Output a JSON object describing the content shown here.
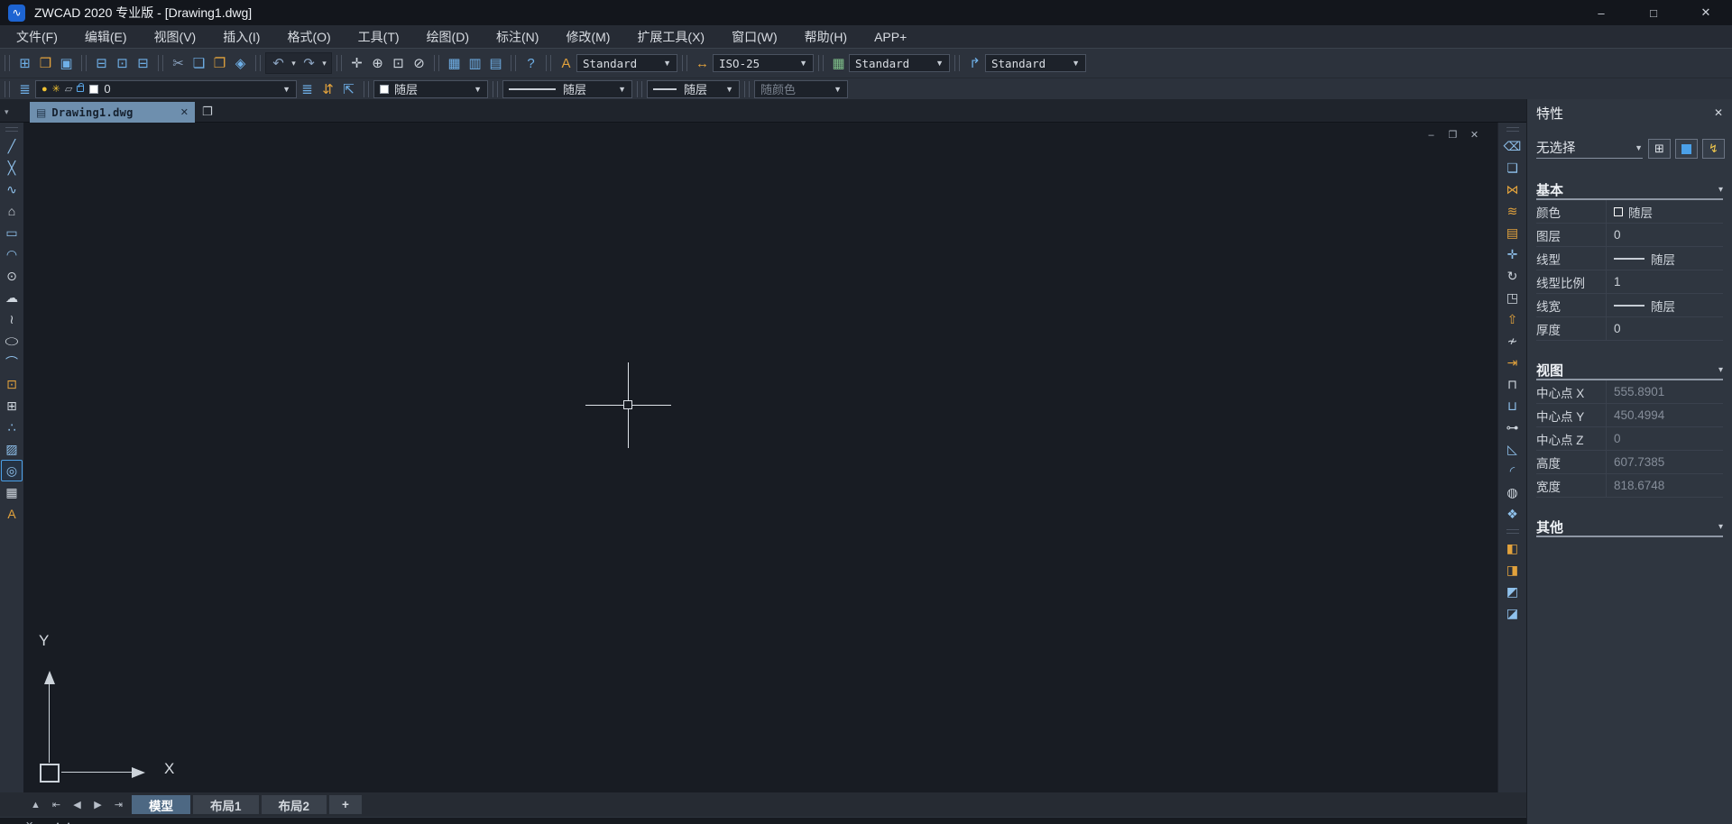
{
  "window": {
    "title": "ZWCAD 2020 专业版 - [Drawing1.dwg]"
  },
  "menu": {
    "items": [
      "文件(F)",
      "编辑(E)",
      "视图(V)",
      "插入(I)",
      "格式(O)",
      "工具(T)",
      "绘图(D)",
      "标注(N)",
      "修改(M)",
      "扩展工具(X)",
      "窗口(W)",
      "帮助(H)",
      "APP+"
    ]
  },
  "toolbars": {
    "styles": {
      "text_style": "Standard",
      "dim_style": "ISO-25",
      "table_style": "Standard",
      "mleader_style": "Standard"
    },
    "layer": {
      "current": "0",
      "color": "随层",
      "linetype": "随层",
      "lineweight": "随层",
      "plot_style": "随颜色"
    }
  },
  "doc_tab": {
    "name": "Drawing1.dwg"
  },
  "panel": {
    "title": "特性",
    "selection": "无选择",
    "basic": {
      "title": "基本",
      "rows": [
        {
          "label": "颜色",
          "value": "随层"
        },
        {
          "label": "图层",
          "value": "0"
        },
        {
          "label": "线型",
          "value": "随层"
        },
        {
          "label": "线型比例",
          "value": "1"
        },
        {
          "label": "线宽",
          "value": "随层"
        },
        {
          "label": "厚度",
          "value": "0"
        }
      ]
    },
    "view": {
      "title": "视图",
      "rows": [
        {
          "label": "中心点 X",
          "value": "555.8901"
        },
        {
          "label": "中心点 Y",
          "value": "450.4994"
        },
        {
          "label": "中心点 Z",
          "value": "0"
        },
        {
          "label": "高度",
          "value": "607.7385"
        },
        {
          "label": "宽度",
          "value": "818.6748"
        }
      ]
    },
    "other": {
      "title": "其他"
    }
  },
  "layout_tabs": {
    "model": "模型",
    "layout1": "布局1",
    "layout2": "布局2",
    "add": "+"
  },
  "ucs": {
    "x": "X",
    "y": "Y"
  },
  "colors": {
    "accent": "#4ba0e8",
    "canvas": "#181c23",
    "tab_active": "#6e8fae",
    "toolbar": "#2c323c",
    "panel": "#2f3640"
  },
  "icons": {
    "logo": "∿",
    "minimize": "–",
    "maximize": "□",
    "close": "✕",
    "restore": "❐",
    "new": "⊞",
    "open": "❒",
    "save": "▣",
    "print": "⊟",
    "print_preview": "⊡",
    "publish": "⊟",
    "cut": "✂",
    "copy": "❏",
    "paste": "❐",
    "match_prop": "◈",
    "undo": "↶",
    "redo": "↷",
    "caret": "▼",
    "small_caret": "▾",
    "pan": "✛",
    "zoom_realtime": "⊕",
    "zoom_window": "⊡",
    "zoom_prev": "⊘",
    "calculator": "▦",
    "quick_table": "▥",
    "sheet_set": "▤",
    "help": "?",
    "text_style": "A",
    "dim_style": "↔",
    "table_style": "▦",
    "mleader_style": "↱",
    "layers": "≣",
    "bulb": "●",
    "sun": "✳",
    "freeze": "▱",
    "layer_states": "≣",
    "layer_prev": "⇵",
    "layer_current": "⇱",
    "line": "╱",
    "xline": "╳",
    "polyline": "∿",
    "polygon": "⌂",
    "rectangle": "▭",
    "arc": "◠",
    "circle": "⊙",
    "revcloud": "☁",
    "spline": "≀",
    "ellipse": "◯",
    "ellipse_arc": "⌒",
    "insert_block": "⊡",
    "make_block": "⊞",
    "point": "∴",
    "hatch": "▨",
    "region": "◎",
    "table": "▦",
    "mtext": "A",
    "erase": "⌫",
    "copy_obj": "❏",
    "mirror": "⋈",
    "offset": "≋",
    "array": "▤",
    "move": "✛",
    "rotate": "↻",
    "scale": "◳",
    "stretch": "⇧",
    "trim": "≁",
    "extend": "⇥",
    "break_pt": "⊓",
    "break": "⊔",
    "join": "⊶",
    "chamfer": "◺",
    "fillet": "◜",
    "wipeout": "◍",
    "explode": "❖",
    "draworder_front": "◧",
    "draworder_back": "◨",
    "draworder_above": "◩",
    "draworder_under": "◪",
    "quick_select": "⊞",
    "select_objects": "↯",
    "tab_up": "▲",
    "tab_first": "⇤",
    "tab_prevb": "◀",
    "tab_nextb": "▶",
    "tab_last": "⇥",
    "cmd_close": "✕",
    "cmd_chevrons": "∧∧"
  }
}
